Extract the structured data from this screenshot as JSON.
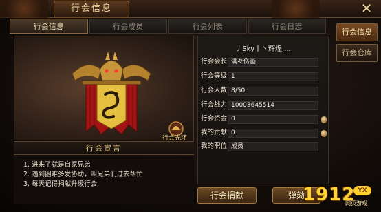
{
  "window": {
    "title": "行会信息",
    "close_symbol": "✕"
  },
  "tabs": [
    {
      "label": "行会信息",
      "active": true
    },
    {
      "label": "行会成员",
      "active": false
    },
    {
      "label": "行会列表",
      "active": false
    },
    {
      "label": "行会日志",
      "active": false
    }
  ],
  "side_tabs": [
    {
      "label": "行会信息",
      "active": true
    },
    {
      "label": "行会仓库",
      "active": false
    }
  ],
  "emblem": {
    "icon": "dragon-banner-icon",
    "glory_label": "行会光环"
  },
  "announcement": {
    "title": "行会宣言",
    "lines": [
      "1. 进来了就是自家兄弟",
      "2. 遇到困难多发协助，叫兄弟们过去帮忙",
      "3. 每天记得捐献升级行会"
    ]
  },
  "info": {
    "guild_name": "丿Sky丨丶辉煌,...",
    "rows": [
      {
        "label": "行会会长:",
        "value": "满々伤画"
      },
      {
        "label": "行会等级:",
        "value": "1"
      },
      {
        "label": "行会人数:",
        "value": "8/50"
      },
      {
        "label": "行会战力:",
        "value": "10003645514"
      },
      {
        "label": "行会资金:",
        "value": "0"
      },
      {
        "label": "我的贡献:",
        "value": "0"
      },
      {
        "label": "我的职位:",
        "value": "成员"
      }
    ]
  },
  "buttons": {
    "donate": "行会捐献",
    "impeach": "弹劾"
  },
  "watermark": {
    "number": "1912",
    "badge": "YX",
    "subtitle": "网页游戏"
  },
  "colors": {
    "accent_gold": "#f1d79a",
    "banner_red": "#b01818",
    "banner_gold": "#e9c44a"
  }
}
